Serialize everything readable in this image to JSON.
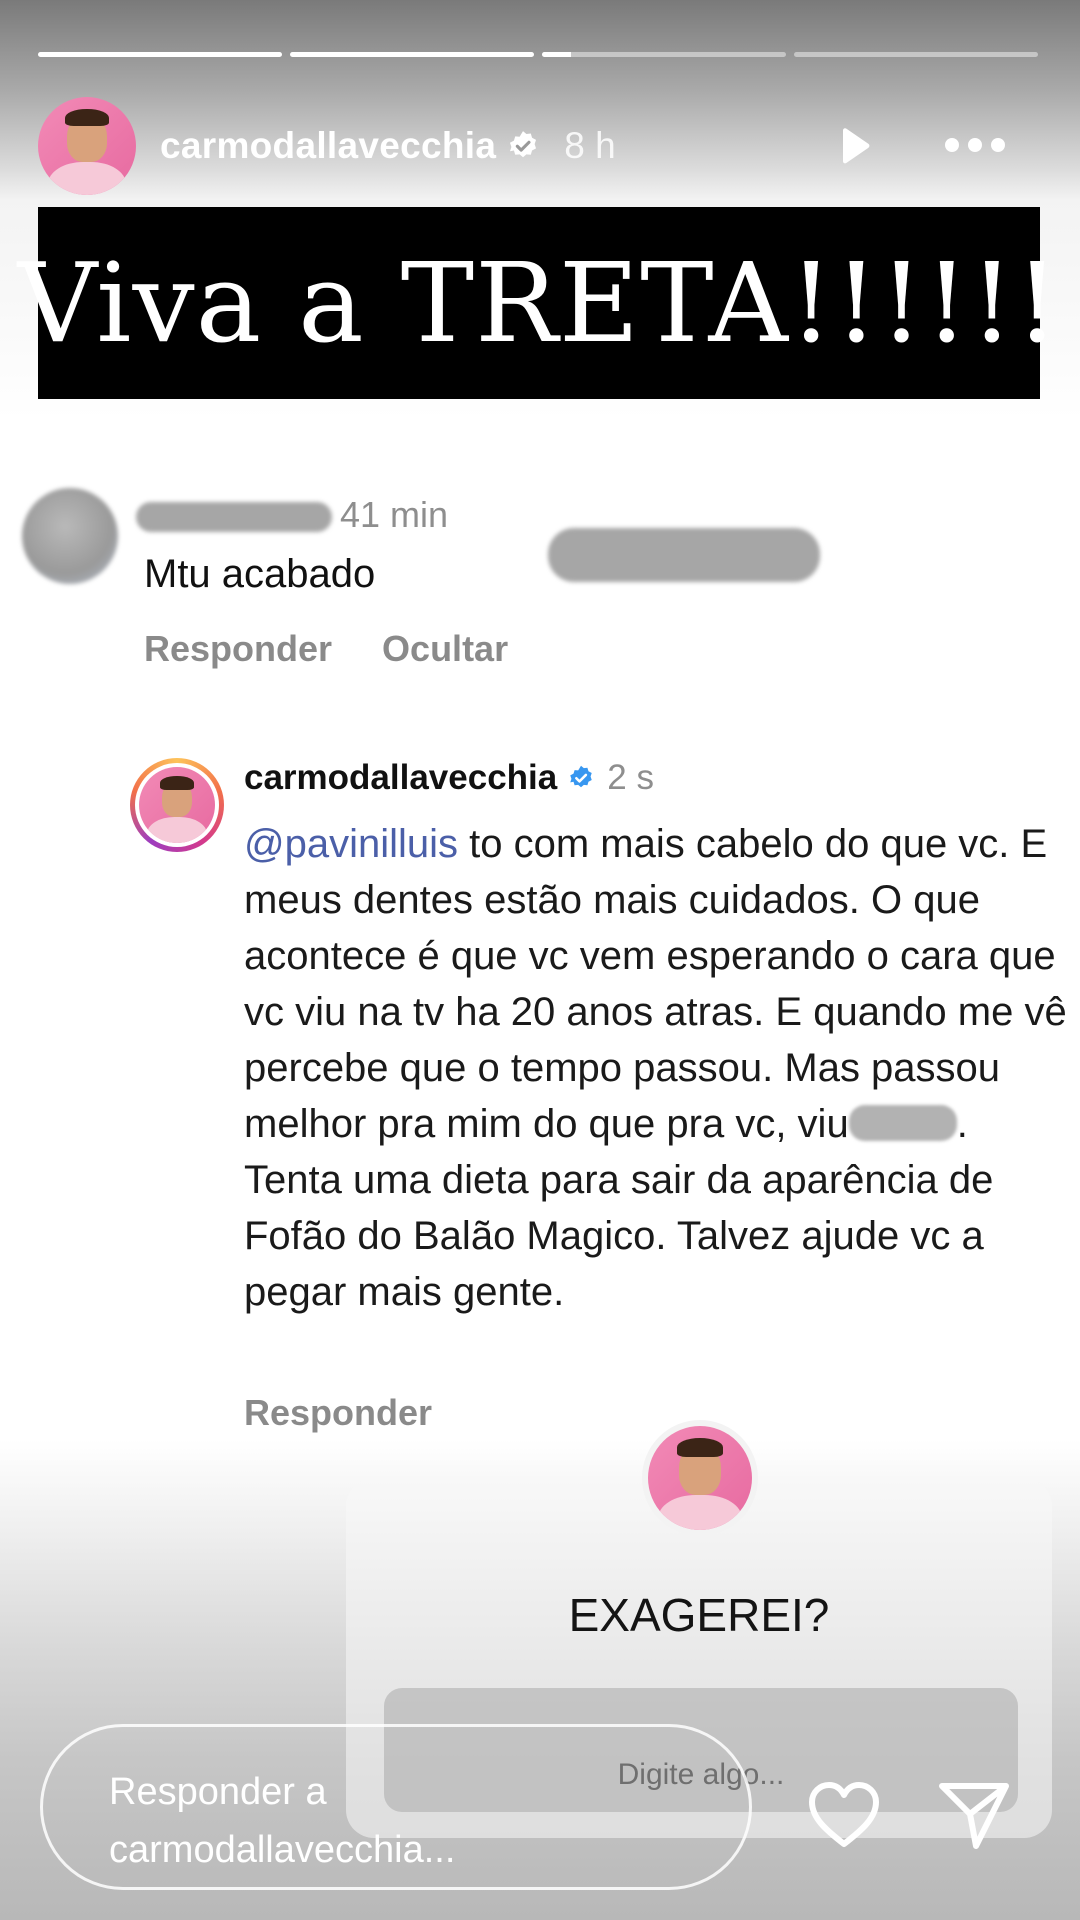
{
  "story": {
    "progress": [
      1,
      1,
      0.12,
      0
    ],
    "header": {
      "username": "carmodallavecchia",
      "time": "8 h"
    },
    "banner_text": "Viva a TRETA!!!!!!"
  },
  "comment": {
    "time": "41 min",
    "text": "Mtu acabado",
    "actions": [
      "Responder",
      "Ocultar"
    ]
  },
  "reply": {
    "username": "carmodallavecchia",
    "time": "2 s",
    "mention": "@pavinilluis",
    "text_a": " to com mais cabelo do que vc. E meus dentes estão mais cuidados. O que acontece é que vc vem esperando o cara que vc viu na tv ha 20 anos atras. E quando me vê percebe que o tempo passou. Mas passou melhor pra mim do que pra vc, viu",
    "text_b": ". Tenta uma dieta para sair da aparência de Fofão do Balão Magico. Talvez ajude vc a pegar mais gente.",
    "action": "Responder"
  },
  "sticker": {
    "question": "EXAGEREI?",
    "placeholder": "Digite algo..."
  },
  "reply_bar": {
    "line1": "Responder a",
    "line2": "carmodallavecchia..."
  },
  "colors": {
    "mention": "#4b5fa8",
    "verified_blue": "#3897f0",
    "banner_bg": "#000000"
  },
  "icons": [
    "verified-badge-icon",
    "play-icon",
    "more-icon",
    "heart-icon",
    "send-icon"
  ]
}
